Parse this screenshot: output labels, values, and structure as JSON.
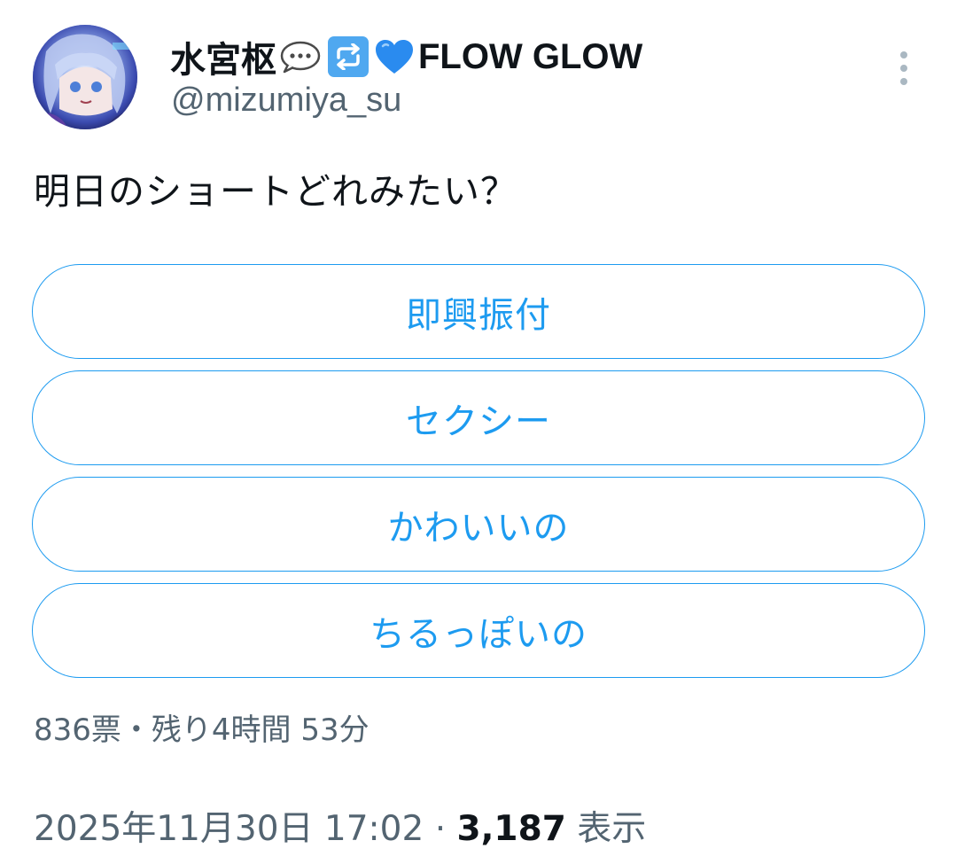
{
  "author": {
    "display_name": "水宮枢",
    "display_name_suffix": "FLOW GLOW",
    "name_emojis": [
      "speech-bubble-icon",
      "repeat-icon",
      "blue-heart-icon"
    ],
    "handle": "@mizumiya_su",
    "avatar": "avatar"
  },
  "tweet": {
    "text": "明日のショートどれみたい？"
  },
  "poll": {
    "options": [
      {
        "label": "即興振付"
      },
      {
        "label": "セクシー"
      },
      {
        "label": "かわいいの"
      },
      {
        "label": "ちるっぽいの"
      }
    ],
    "meta": "836票・残り4時間 53分"
  },
  "footer": {
    "datetime": "2025年11月30日 17:02 · ",
    "views_count": "3,187",
    "views_label": " 表示"
  },
  "colors": {
    "accent": "#1d9bf0",
    "secondary_text": "#536471",
    "primary_text": "#0f1419"
  },
  "icons": {
    "more": "more-vertical-icon"
  }
}
